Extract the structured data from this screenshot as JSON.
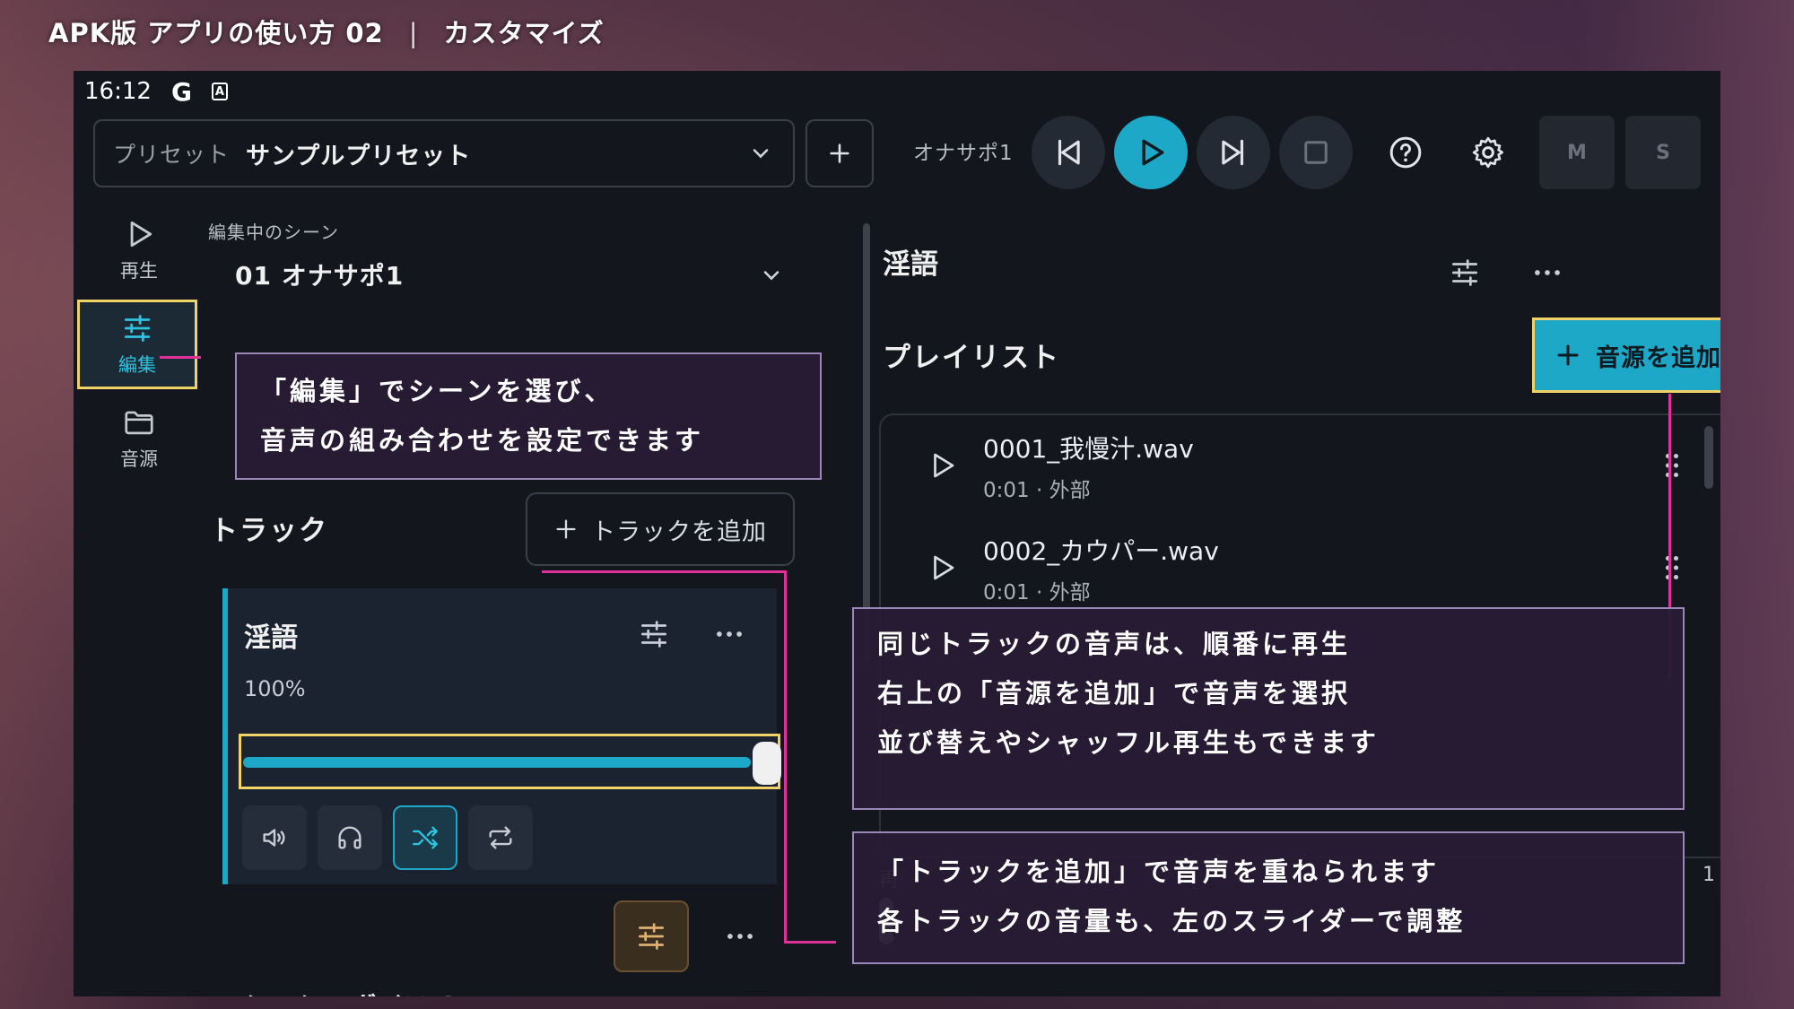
{
  "video_title": {
    "main": "APK版 アプリの使い方 02",
    "separator": "|",
    "sub": "カスタマイズ"
  },
  "statusbar": {
    "time": "16:12",
    "g_icon": "G",
    "a_icon": "A"
  },
  "topbar": {
    "preset_label": "プリセット",
    "preset_value": "サンプルプリセット",
    "scene_name": "オナサポ1",
    "m_label": "M",
    "s_label": "S"
  },
  "sidebar": {
    "items": [
      {
        "label": "再生",
        "icon": "play-icon"
      },
      {
        "label": "編集",
        "icon": "sliders-icon"
      },
      {
        "label": "音源",
        "icon": "folder-icon"
      }
    ]
  },
  "scene": {
    "editing_label": "編集中のシーン",
    "selected": "01 オナサポ1"
  },
  "tracks": {
    "title": "トラック",
    "add_label": "トラックを追加",
    "items": [
      {
        "name": "淫語",
        "volume_text": "100%",
        "volume": 100
      },
      {
        "name": "シコシコボイス_L"
      }
    ]
  },
  "detail": {
    "title": "淫語",
    "playlist_title": "プレイリスト",
    "add_source_label": "音源を追加",
    "playlist": [
      {
        "name": "0001_我慢汁.wav",
        "meta": "0:01 · 外部"
      },
      {
        "name": "0002_カウパー.wav",
        "meta": "0:01 · 外部"
      }
    ],
    "peek_left": "再",
    "peek_right": "1"
  },
  "callouts": {
    "edit": [
      "「編集」でシーンを選び、",
      "音声の組み合わせを設定できます"
    ],
    "playlist": [
      "同じトラックの音声は、順番に再生",
      "右上の「音源を追加」で音声を選択",
      "並び替えやシャッフル再生もできます"
    ],
    "tracks": [
      "「トラックを追加」で音声を重ねられます",
      "各トラックの音量も、左のスライダーで調整"
    ]
  },
  "colors": {
    "accent": "#1ea8c8",
    "highlight": "#f0d266",
    "callout_line": "#e0309a",
    "background": "#13161c"
  }
}
